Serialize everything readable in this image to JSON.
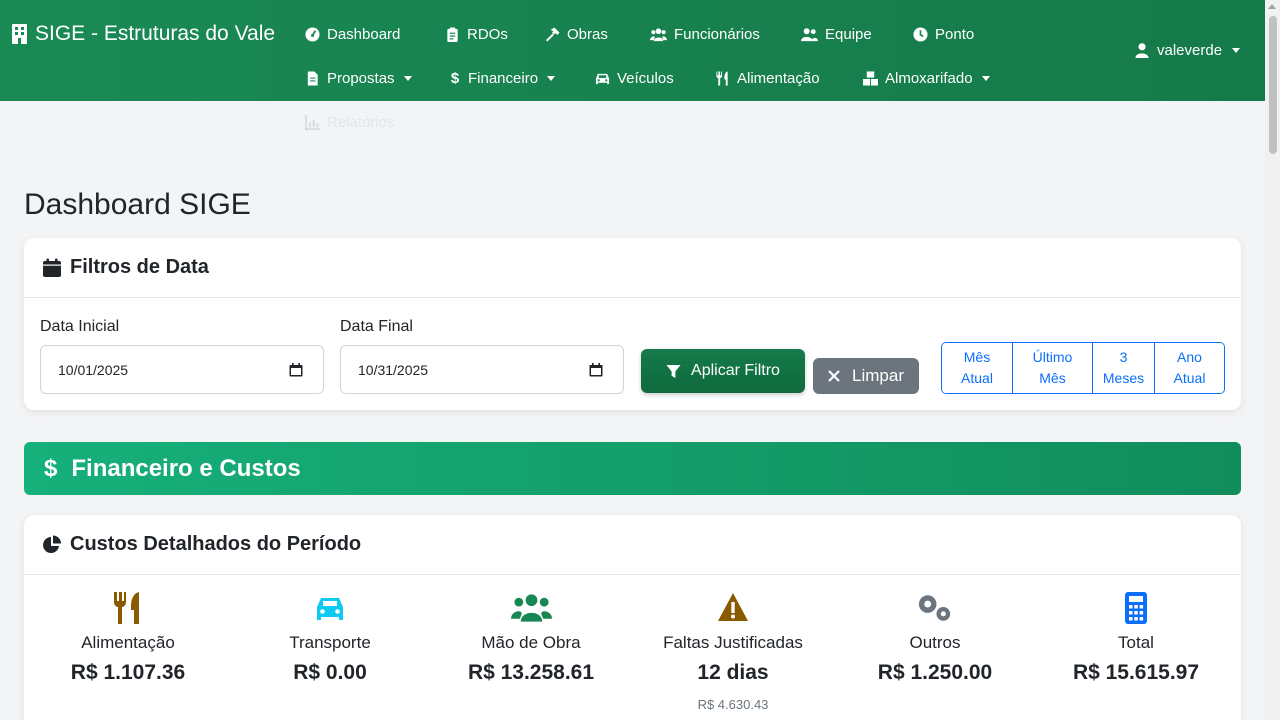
{
  "nav": {
    "brand": "SIGE - Estruturas do Vale",
    "items": [
      {
        "label": "Dashboard",
        "icon": "gauge-icon"
      },
      {
        "label": "RDOs",
        "icon": "clipboard-icon"
      },
      {
        "label": "Obras",
        "icon": "hammer-icon"
      },
      {
        "label": "Funcionários",
        "icon": "users-icon"
      },
      {
        "label": "Equipe",
        "icon": "user-group-icon"
      },
      {
        "label": "Ponto",
        "icon": "clock-icon"
      },
      {
        "label": "Propostas",
        "icon": "file-icon",
        "dropdown": true
      },
      {
        "label": "Financeiro",
        "icon": "dollar-icon",
        "dropdown": true
      },
      {
        "label": "Veículos",
        "icon": "car-icon"
      },
      {
        "label": "Alimentação",
        "icon": "utensils-icon"
      },
      {
        "label": "Almoxarifado",
        "icon": "boxes-icon",
        "dropdown": true
      },
      {
        "label": "Relatórios",
        "icon": "chart-icon"
      }
    ],
    "user": "valeverde"
  },
  "page": {
    "title": "Dashboard SIGE"
  },
  "filters": {
    "title": "Filtros de Data",
    "start_label": "Data Inicial",
    "start_value": "10/01/2025",
    "end_label": "Data Final",
    "end_value": "10/31/2025",
    "apply_label": "Aplicar Filtro",
    "clear_label": "Limpar",
    "quick": [
      {
        "line1": "Mês",
        "line2": "Atual"
      },
      {
        "line1": "Último",
        "line2": "Mês"
      },
      {
        "line1": "3",
        "line2": "Meses"
      },
      {
        "line1": "Ano",
        "line2": "Atual"
      }
    ]
  },
  "section": {
    "title": "Financeiro e Custos"
  },
  "costs": {
    "title": "Custos Detalhados do Período",
    "items": [
      {
        "label": "Alimentação",
        "value": "R$ 1.107.36",
        "icon": "utensils-icon",
        "color": "#8a5a00"
      },
      {
        "label": "Transporte",
        "value": "R$ 0.00",
        "icon": "car-icon",
        "color": "#0dcaf0"
      },
      {
        "label": "Mão de Obra",
        "value": "R$ 13.258.61",
        "icon": "users-icon",
        "color": "#198754"
      },
      {
        "label": "Faltas Justificadas",
        "value": "12 dias",
        "sub": "R$ 4.630.43",
        "icon": "warning-icon",
        "color": "#8a5a00"
      },
      {
        "label": "Outros",
        "value": "R$ 1.250.00",
        "icon": "cogs-icon",
        "color": "#6c757d"
      },
      {
        "label": "Total",
        "value": "R$ 15.615.97",
        "icon": "calculator-icon",
        "color": "#0d6efd"
      }
    ]
  }
}
